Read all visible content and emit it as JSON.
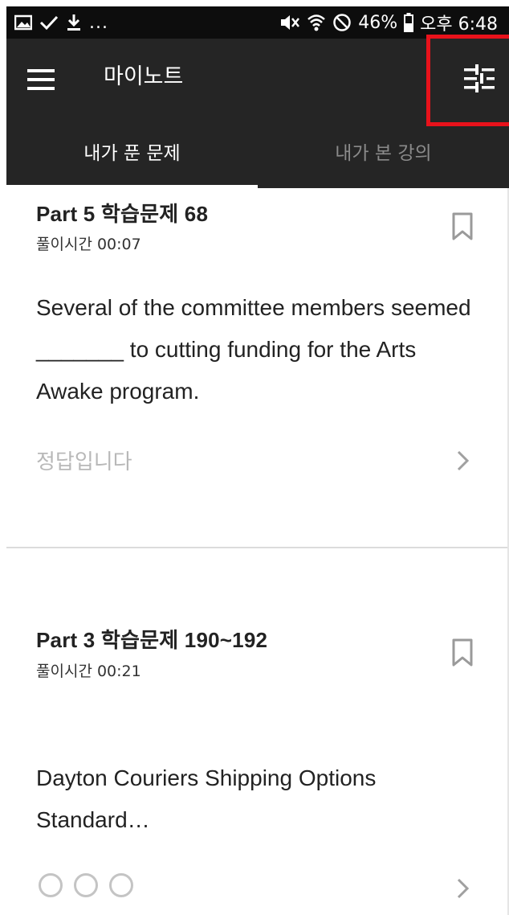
{
  "status_bar": {
    "left_icons": [
      "image-icon",
      "check-icon",
      "download-icon"
    ],
    "ellipsis": "...",
    "right_icons": [
      "mute-icon",
      "wifi-icon",
      "do-not-disturb-icon",
      "battery-icon"
    ],
    "battery": "46%",
    "time": "오후 6:48"
  },
  "app_bar": {
    "title": "마이노트",
    "menu_icon": "hamburger-menu-icon",
    "filter_icon": "filter-sliders-icon",
    "highlight_color": "#e8121b"
  },
  "tabs": [
    {
      "label": "내가 푼 문제",
      "active": true
    },
    {
      "label": "내가 본 강의",
      "active": false
    }
  ],
  "cards": [
    {
      "title": "Part 5 학습문제 68",
      "time": "풀이시간 00:07",
      "question": "Several of the committee members seemed _______ to cutting funding for the Arts Awake program.",
      "status": "정답입니다"
    },
    {
      "title": "Part 3 학습문제 190~192",
      "time": "풀이시간 00:21",
      "question": "Dayton Couriers Shipping Options Standard…",
      "answer_marks": [
        "circle",
        "circle",
        "circle"
      ]
    }
  ],
  "colors": {
    "app_bar": "#252525",
    "status_bar": "#0d0d0d",
    "active_tab": "#ffffff",
    "inactive_tab": "#8a8a8a"
  }
}
